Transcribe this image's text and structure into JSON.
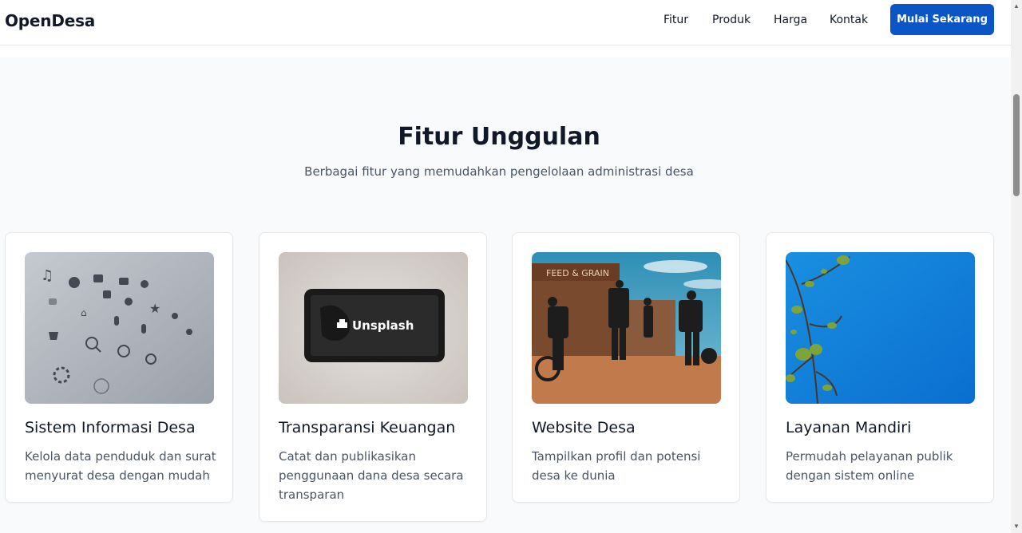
{
  "brand": "OpenDesa",
  "nav": {
    "links": [
      "Fitur",
      "Produk",
      "Harga",
      "Kontak"
    ],
    "cta_label": "Mulai Sekarang"
  },
  "features": {
    "title": "Fitur Unggulan",
    "subtitle": "Berbagai fitur yang memudahkan pengelolaan administrasi desa",
    "cards": [
      {
        "title": "Sistem Informasi Desa",
        "description": "Kelola data penduduk dan surat menyurat desa dengan mudah",
        "image": "icons-pattern-photo"
      },
      {
        "title": "Transparansi Keuangan",
        "description": "Catat dan publikasikan penggunaan dana desa secara transparan",
        "image": "unsplash-phone-photo",
        "image_text": "Unsplash"
      },
      {
        "title": "Website Desa",
        "description": "Tampilkan profil dan potensi desa ke dunia",
        "image": "western-town-photo",
        "image_text": "FEED & GRAIN"
      },
      {
        "title": "Layanan Mandiri",
        "description": "Permudah pelayanan publik dengan sistem online",
        "image": "blue-sky-branch-photo"
      }
    ]
  },
  "colors": {
    "primary": "#0b55c6",
    "background": "#f9fafb",
    "text": "#111827",
    "muted": "#4b5563"
  }
}
